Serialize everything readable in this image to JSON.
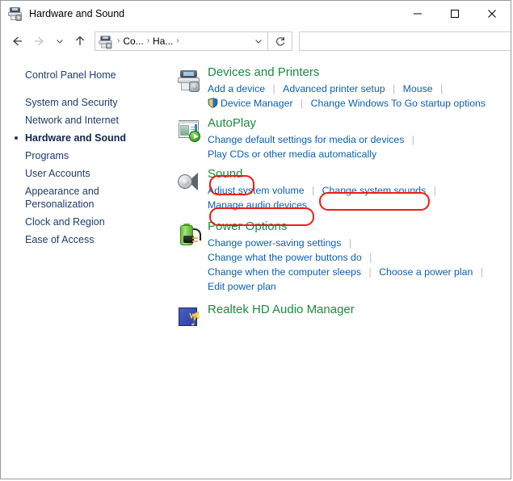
{
  "window": {
    "title": "Hardware and Sound",
    "title_icon": "printer-camera-icon",
    "minimize_label": "Minimize",
    "maximize_label": "Maximize",
    "close_label": "Close"
  },
  "toolbar": {
    "back_label": "Back",
    "forward_label": "Forward",
    "recent_label": "Recent locations",
    "up_label": "Up",
    "refresh_label": "Refresh",
    "address_icon": "printer-camera-icon",
    "breadcrumbs": [
      {
        "label": "Co...",
        "separator": "›"
      },
      {
        "label": "Ha...",
        "separator": "›"
      }
    ],
    "address_dropdown": "ˇ",
    "search": {
      "value": "",
      "placeholder": ""
    }
  },
  "sidebar": {
    "items": [
      {
        "label": "Control Panel Home",
        "current": false
      },
      {
        "label": "System and Security",
        "current": false
      },
      {
        "label": "Network and Internet",
        "current": false
      },
      {
        "label": "Hardware and Sound",
        "current": true
      },
      {
        "label": "Programs",
        "current": false
      },
      {
        "label": "User Accounts",
        "current": false
      },
      {
        "label": "Appearance and Personalization",
        "current": false
      },
      {
        "label": "Clock and Region",
        "current": false
      },
      {
        "label": "Ease of Access",
        "current": false
      }
    ]
  },
  "main": {
    "categories": [
      {
        "icon": "devices-and-printers-icon",
        "title": "Devices and Printers",
        "rows": [
          [
            {
              "text": "Add a device",
              "shield": false
            },
            {
              "text": "Advanced printer setup",
              "shield": false
            },
            {
              "text": "Mouse",
              "shield": false,
              "trailing_separator": true
            }
          ],
          [
            {
              "text": "Device Manager",
              "shield": true
            },
            {
              "text": "Change Windows To Go startup options",
              "shield": false
            }
          ]
        ]
      },
      {
        "icon": "autoplay-icon",
        "title": "AutoPlay",
        "rows": [
          [
            {
              "text": "Change default settings for media or devices",
              "shield": false,
              "trailing_separator": true
            }
          ],
          [
            {
              "text": "Play CDs or other media automatically",
              "shield": false
            }
          ]
        ]
      },
      {
        "icon": "speaker-icon",
        "title": "Sound",
        "title_annotated": true,
        "rows": [
          [
            {
              "text": "Adjust system volume",
              "shield": false
            },
            {
              "text": "Change system sounds",
              "shield": false,
              "annotated": true,
              "trailing_separator": true
            }
          ],
          [
            {
              "text": "Manage audio devices",
              "shield": false,
              "annotated": true
            }
          ]
        ]
      },
      {
        "icon": "power-battery-icon",
        "title": "Power Options",
        "rows": [
          [
            {
              "text": "Change power-saving settings",
              "shield": false,
              "trailing_separator": true
            }
          ],
          [
            {
              "text": "Change what the power buttons do",
              "shield": false,
              "trailing_separator": true
            }
          ],
          [
            {
              "text": "Change when the computer sleeps",
              "shield": false
            },
            {
              "text": "Choose a power plan",
              "shield": false,
              "trailing_separator": true
            }
          ],
          [
            {
              "text": "Edit power plan",
              "shield": false
            }
          ]
        ]
      },
      {
        "icon": "realtek-audio-icon",
        "title": "Realtek HD Audio Manager",
        "rows": []
      }
    ]
  },
  "annotations": {
    "color": "#ef1b17",
    "targets": [
      "Sound",
      "Change system sounds",
      "Manage audio devices"
    ]
  }
}
